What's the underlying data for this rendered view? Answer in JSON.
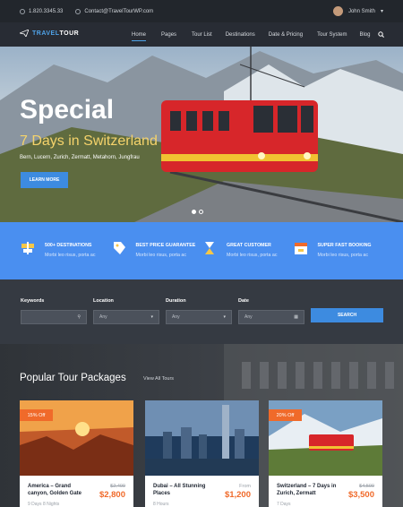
{
  "topbar": {
    "phone": "1.820.3345.33",
    "email": "Contact@TravelTourWP.com",
    "user_name": "John Smith"
  },
  "nav": {
    "logo_a": "TRAVEL",
    "logo_b": "TOUR",
    "items": [
      {
        "label": "Home",
        "active": true
      },
      {
        "label": "Pages"
      },
      {
        "label": "Tour List"
      },
      {
        "label": "Destinations"
      },
      {
        "label": "Date & Pricing"
      },
      {
        "label": "Tour System"
      },
      {
        "label": "Blog"
      }
    ],
    "icons": {
      "search": "search-icon",
      "phone": "phone-icon",
      "mail": "mail-icon",
      "plane": "plane-icon"
    }
  },
  "hero": {
    "title": "Special",
    "subtitle": "7 Days in Switzerland",
    "places": "Bern, Lucern, Zurich, Zermatt, Metahorn, Jungfrau",
    "button": "LEARN MORE",
    "slides": 2,
    "active_slide": 1
  },
  "features": [
    {
      "title": "500+ DESTINATIONS",
      "desc": "Morbi leo risus, porta ac",
      "icon": "map-signpost-icon"
    },
    {
      "title": "BEST PRICE GUARANTEE",
      "desc": "Morbi leo risus, porta ac",
      "icon": "price-tag-icon"
    },
    {
      "title": "GREAT CUSTOMER",
      "desc": "Morbi leo risus, porta ac",
      "icon": "hourglass-icon"
    },
    {
      "title": "SUPER FAST BOOKING",
      "desc": "Morbi leo risus, porta ac",
      "icon": "calendar-icon"
    }
  ],
  "search": {
    "keywords_label": "Keywords",
    "location_label": "Location",
    "location_value": "Any",
    "duration_label": "Duration",
    "duration_value": "Any",
    "date_label": "Date",
    "button": "SEARCH"
  },
  "popular": {
    "title": "Popular Tour Packages",
    "view_all": "View All Tours",
    "cards": [
      {
        "badge": "15% Off",
        "name": "America – Grand canyon, Golden Gate",
        "old_price": "$2,400",
        "price": "$2,800",
        "duration": "9 Days 8 Nights"
      },
      {
        "name": "Dubai – All Stunning Places",
        "from": "From",
        "price": "$1,200",
        "duration": "8 Hours"
      },
      {
        "badge": "20% Off",
        "name": "Switzerland – 7 Days in Zurich, Zermatt",
        "old_price": "$4,500",
        "price": "$3,500",
        "duration": "7 Days"
      }
    ]
  },
  "colors": {
    "accent": "#3d8be0",
    "orange": "#f06a2a",
    "band": "#4a8ff0"
  }
}
